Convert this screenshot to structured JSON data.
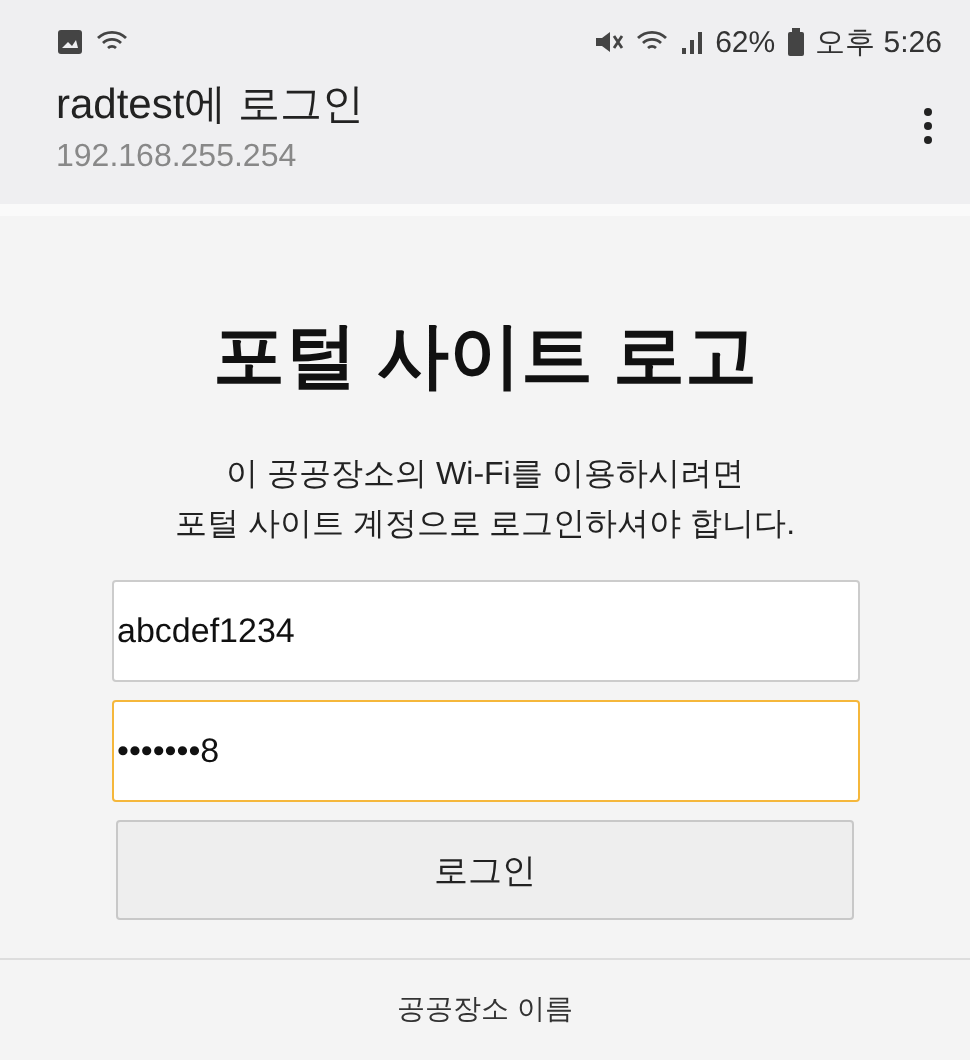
{
  "status_bar": {
    "battery": "62%",
    "time": "오후 5:26"
  },
  "header": {
    "title": "radtest에 로그인",
    "subtitle": "192.168.255.254"
  },
  "portal": {
    "title": "포털 사이트 로고",
    "description": [
      "이 공공장소의 Wi-Fi를 이용하시려면",
      "포털 사이트 계정으로 로그인하셔야 합니다."
    ],
    "fields": [
      {
        "value": "abcdef1234",
        "focused": false
      },
      {
        "value": "•••••••8",
        "focused": true
      }
    ],
    "button": "로그인"
  },
  "footer": "공공장소 이름"
}
